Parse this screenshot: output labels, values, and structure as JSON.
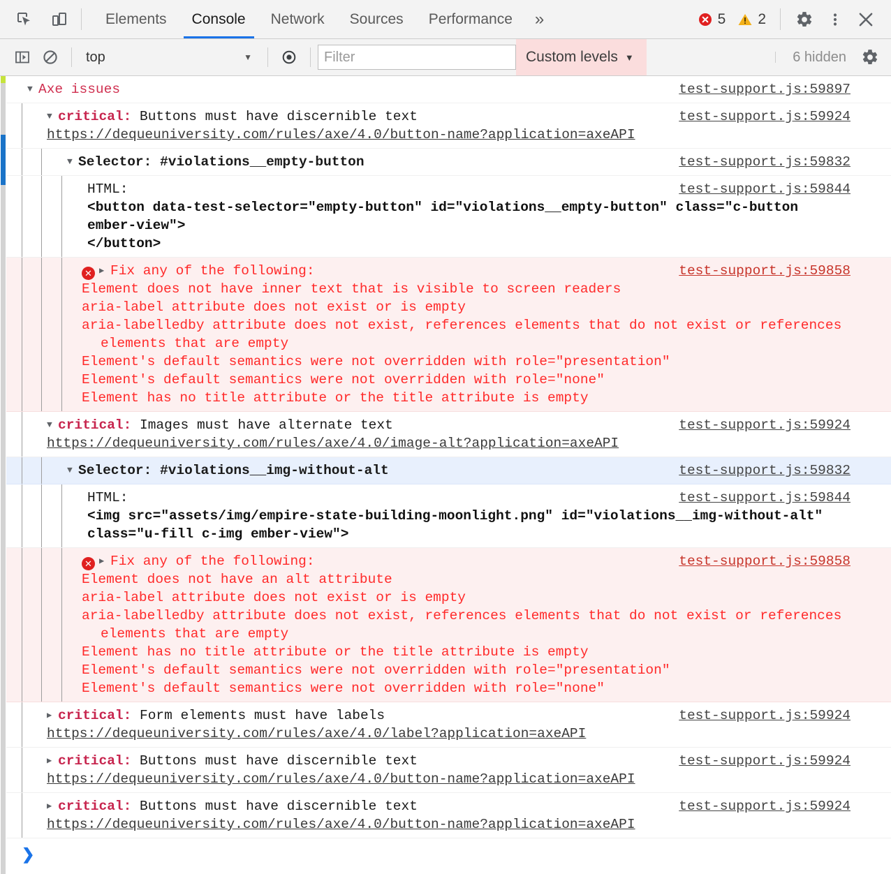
{
  "toolbar": {
    "inspect_icon": "inspect-element-icon",
    "device_icon": "device-toolbar-icon",
    "tabs": [
      {
        "label": "Elements",
        "active": false
      },
      {
        "label": "Console",
        "active": true
      },
      {
        "label": "Network",
        "active": false
      },
      {
        "label": "Sources",
        "active": false
      },
      {
        "label": "Performance",
        "active": false
      }
    ],
    "more_tabs": "»",
    "error_count": "5",
    "warning_count": "2",
    "settings_icon": "gear-icon",
    "menu_icon": "kebab-menu-icon",
    "close_icon": "close-icon"
  },
  "filterbar": {
    "sidebar_icon": "console-sidebar-icon",
    "clear_icon": "clear-console-icon",
    "context": "top",
    "context_caret": "▼",
    "eye_icon": "live-expression-icon",
    "filter_placeholder": "Filter",
    "filter_value": "",
    "levels_label": "Custom levels",
    "levels_caret": "▼",
    "hidden_label": "6 hidden",
    "settings_icon": "console-settings-gear-icon"
  },
  "console": {
    "group_title": "Axe issues",
    "group_source": "test-support.js:59897",
    "entries": [
      {
        "severity": "critical:",
        "message": " Buttons must have discernible text",
        "source": "test-support.js:59924",
        "url": "https://dequeuniversity.com/rules/axe/4.0/button-name?application=axeAPI",
        "expanded": true,
        "selector_label": "Selector:",
        "selector_value": " #violations__empty-button",
        "selector_source": "test-support.js:59832",
        "html_label": "HTML:",
        "html_source": "test-support.js:59844",
        "html_snippet": "<button data-test-selector=\"empty-button\" id=\"violations__empty-button\" class=\"c-button ember-view\">\n</button>",
        "fix_header": "Fix any of the following:",
        "fix_source": "test-support.js:59858",
        "fix_lines": [
          "Element does not have inner text that is visible to screen readers",
          "aria-label attribute does not exist or is empty",
          "aria-labelledby attribute does not exist, references elements that do not exist or references elements that are empty",
          "Element's default semantics were not overridden with role=\"presentation\"",
          "Element's default semantics were not overridden with role=\"none\"",
          "Element has no title attribute or the title attribute is empty"
        ]
      },
      {
        "severity": "critical:",
        "message": " Images must have alternate text",
        "source": "test-support.js:59924",
        "url": "https://dequeuniversity.com/rules/axe/4.0/image-alt?application=axeAPI",
        "expanded": true,
        "selector_label": "Selector:",
        "selector_value": " #violations__img-without-alt",
        "selector_source": "test-support.js:59832",
        "selector_highlighted": true,
        "html_label": "HTML:",
        "html_source": "test-support.js:59844",
        "html_snippet": "<img src=\"assets/img/empire-state-building-moonlight.png\" id=\"violations__img-without-alt\" class=\"u-fill c-img ember-view\">",
        "fix_header": "Fix any of the following:",
        "fix_source": "test-support.js:59858",
        "fix_lines": [
          "Element does not have an alt attribute",
          "aria-label attribute does not exist or is empty",
          "aria-labelledby attribute does not exist, references elements that do not exist or references elements that are empty",
          "Element has no title attribute or the title attribute is empty",
          "Element's default semantics were not overridden with role=\"presentation\"",
          "Element's default semantics were not overridden with role=\"none\""
        ]
      },
      {
        "severity": "critical:",
        "message": " Form elements must have labels",
        "source": "test-support.js:59924",
        "url": "https://dequeuniversity.com/rules/axe/4.0/label?application=axeAPI",
        "expanded": false
      },
      {
        "severity": "critical:",
        "message": " Buttons must have discernible text",
        "source": "test-support.js:59924",
        "url": "https://dequeuniversity.com/rules/axe/4.0/button-name?application=axeAPI",
        "expanded": false
      },
      {
        "severity": "critical:",
        "message": " Buttons must have discernible text",
        "source": "test-support.js:59924",
        "url": "https://dequeuniversity.com/rules/axe/4.0/button-name?application=axeAPI",
        "expanded": false
      }
    ],
    "prompt_chevron": "❯",
    "triangle_open": "▼",
    "triangle_closed": "▶"
  },
  "colors": {
    "accent": "#1a73e8",
    "error": "#e02020",
    "warning": "#f0ad00",
    "critical_text": "#c7254e",
    "error_row_bg": "#fdf0f0",
    "selected_row_bg": "#e8f0fd",
    "levels_bg": "#fbdddd"
  }
}
